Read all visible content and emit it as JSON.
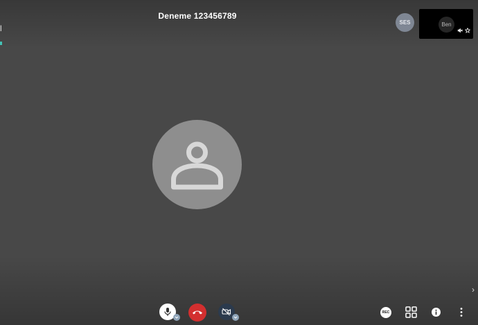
{
  "meeting": {
    "title": "Deneme 123456789"
  },
  "left_edge": {
    "glyph": "l",
    "accent_color": "#44c2b5"
  },
  "participants": [
    {
      "initials": "SES",
      "avatar_color": "#7f8794"
    }
  ],
  "self_view": {
    "name": "Ben",
    "icons": [
      "mic-muted-icon",
      "star-icon"
    ]
  },
  "main_stage": {
    "avatar_icon": "person-icon"
  },
  "toolbar": {
    "center": [
      {
        "name": "mic-button",
        "icon": "microphone-icon",
        "has_options": true
      },
      {
        "name": "hangup-button",
        "icon": "phone-hangup-icon",
        "color": "#d32f2f"
      },
      {
        "name": "camera-button",
        "icon": "video-off-icon",
        "has_options": true
      }
    ],
    "right": [
      {
        "name": "record-button",
        "label": "REC"
      },
      {
        "name": "tile-view-button",
        "icon": "grid-icon"
      },
      {
        "name": "info-button",
        "icon": "info-icon"
      },
      {
        "name": "more-button",
        "icon": "more-vertical-icon"
      }
    ]
  },
  "side_nav": {
    "icon": "chevron-right-icon"
  }
}
